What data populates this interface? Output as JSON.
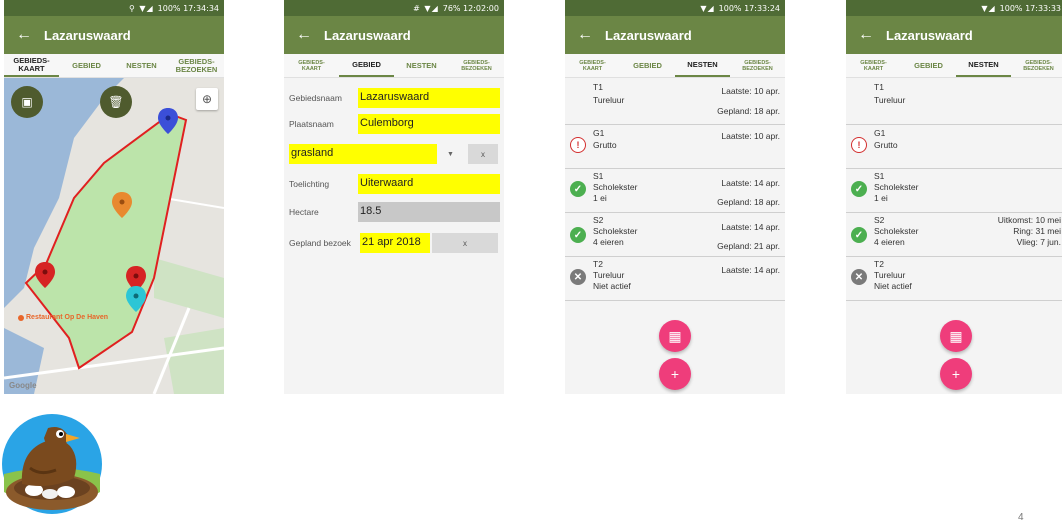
{
  "app_title": "Lazaruswaard",
  "back_icon": "←",
  "screens": [
    {
      "status": "100% 17:34:34",
      "status_icons": "⚲ ▼◢"
    },
    {
      "status": "76% 12:02:00",
      "status_icons": "# ▼◢"
    },
    {
      "status": "100% 17:33:24",
      "status_icons": "▼◢"
    },
    {
      "status": "100% 17:33:33",
      "status_icons": "▼◢"
    }
  ],
  "tabs": {
    "kaart": "GEBIEDS-\nKAART",
    "gebied": "GEBIED",
    "nesten": "NESTEN",
    "bezoeken": "GEBIEDS-\nBEZOEKEN"
  },
  "map": {
    "place_label": "Restaurant Op De Haven",
    "google": "Google",
    "image_icon": "image-icon",
    "delete_icon": "trash-icon",
    "locate_icon": "crosshair-icon",
    "colors": {
      "polygon_fill": "#b9e4a6",
      "polygon_stroke": "#e02020",
      "water": "#9bb8d8"
    }
  },
  "gebied": {
    "gebiedsnaam_label": "Gebiedsnaam",
    "gebiedsnaam": "Lazaruswaard",
    "plaatsnaam_label": "Plaatsnaam",
    "plaatsnaam": "Culemborg",
    "type_value": "grasland",
    "clear_label": "x",
    "toelichting_label": "Toelichting",
    "toelichting": "Uiterwaard",
    "hectare_label": "Hectare",
    "hectare": "18.5",
    "gepland_label": "Gepland bezoek",
    "gepland": "21 apr 2018"
  },
  "nests_a": [
    {
      "code": "T1",
      "species": "Tureluur",
      "extra": "",
      "icon": "none",
      "right1": "Laatste: 10 apr.",
      "right2": "Gepland: 18 apr."
    },
    {
      "code": "G1",
      "species": "Grutto",
      "extra": "",
      "icon": "warning-icon",
      "right1": "Laatste: 10 apr.",
      "right2": ""
    },
    {
      "code": "S1",
      "species": "Scholekster",
      "extra": "1 ei",
      "icon": "check-icon",
      "right1": "Laatste: 14 apr.",
      "right2": "Gepland: 18 apr."
    },
    {
      "code": "S2",
      "species": "Scholekster",
      "extra": "4 eieren",
      "icon": "check-icon",
      "right1": "Laatste: 14 apr.",
      "right2": "Gepland: 21 apr."
    },
    {
      "code": "T2",
      "species": "Tureluur",
      "extra": "Niet actief",
      "icon": "x-icon",
      "right1": "Laatste: 14 apr.",
      "right2": ""
    }
  ],
  "nests_b": [
    {
      "code": "T1",
      "species": "Tureluur",
      "extra": "",
      "right1": "",
      "right2": "",
      "right3": ""
    },
    {
      "code": "G1",
      "species": "Grutto",
      "extra": "",
      "right1": "",
      "right2": "",
      "right3": ""
    },
    {
      "code": "S1",
      "species": "Scholekster",
      "extra": "1 ei",
      "right1": "",
      "right2": "",
      "right3": ""
    },
    {
      "code": "S2",
      "species": "Scholekster",
      "extra": "4 eieren",
      "right1": "Uitkomst: 10 mei",
      "right2": "Ring: 31 mei",
      "right3": "Vlieg: 7 jun."
    },
    {
      "code": "T2",
      "species": "Tureluur",
      "extra": "Niet actief",
      "right1": "",
      "right2": "",
      "right3": ""
    }
  ],
  "fab_calendar_icon": "calendar-icon",
  "fab_add": "+",
  "page_number": "4",
  "accent": "#6b8645",
  "pink": "#ef3d7b"
}
